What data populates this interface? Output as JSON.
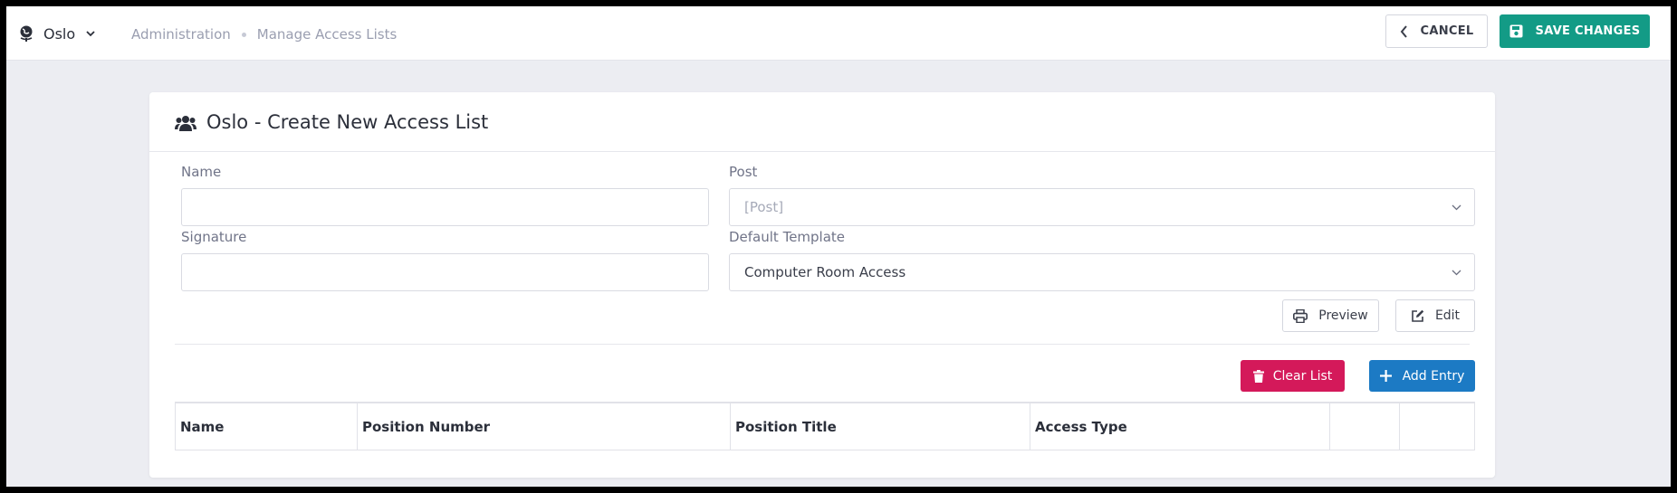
{
  "header": {
    "site_name": "Oslo",
    "breadcrumb": [
      "Administration",
      "Manage Access Lists"
    ],
    "cancel_label": "CANCEL",
    "save_label": "SAVE CHANGES"
  },
  "card": {
    "title": "Oslo - Create New Access List"
  },
  "form": {
    "name": {
      "label": "Name",
      "value": ""
    },
    "post": {
      "label": "Post",
      "placeholder": "[Post]"
    },
    "signature": {
      "label": "Signature",
      "value": ""
    },
    "default_template": {
      "label": "Default Template",
      "value": "Computer Room Access"
    }
  },
  "template_actions": {
    "preview_label": "Preview",
    "edit_label": "Edit"
  },
  "list_actions": {
    "clear_label": "Clear List",
    "add_label": "Add Entry"
  },
  "table": {
    "columns": [
      "Name",
      "Position Number",
      "Position Title",
      "Access Type",
      "",
      ""
    ]
  },
  "colors": {
    "save": "#139b86",
    "clear": "#d4195a",
    "add": "#1c7ac4"
  },
  "icons": [
    "globe-icon",
    "chevron-down-icon",
    "chevron-left-icon",
    "save-icon",
    "users-icon",
    "printer-icon",
    "edit-icon",
    "trash-icon",
    "plus-icon"
  ]
}
